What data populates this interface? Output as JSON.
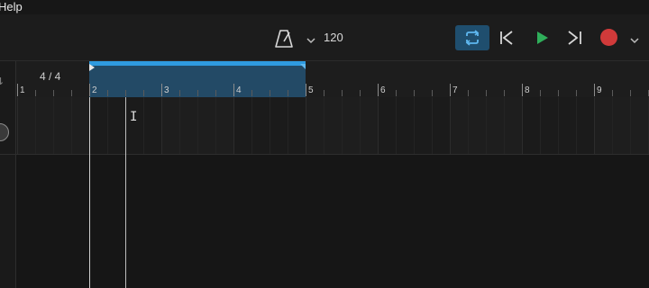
{
  "menubar": {
    "help_label": "Help"
  },
  "toolbar": {
    "tempo": "120",
    "icons": {
      "metronome": "metronome-icon",
      "metronome_dropdown": "chevron-down-icon",
      "loop": "loop-icon",
      "go_to_start": "skip-back-icon",
      "play": "play-icon",
      "go_to_end": "skip-forward-icon",
      "record": "record-icon",
      "record_dropdown": "chevron-down-icon"
    },
    "loop_active": true
  },
  "ruler": {
    "time_signature": "4 / 4",
    "bars": [
      "1",
      "2",
      "3",
      "4",
      "5",
      "6",
      "7",
      "8",
      "9"
    ],
    "loop_region": {
      "start_bar": "2",
      "end_bar": "5"
    }
  },
  "colors": {
    "accent": "#2f9be0",
    "loop_button_bg": "#1f4e6e",
    "play": "#2fae5a",
    "record": "#d13a3a",
    "background": "#161616"
  }
}
